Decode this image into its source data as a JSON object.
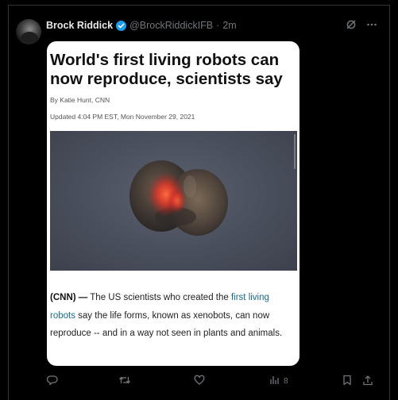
{
  "post": {
    "author_name": "Brock Riddick",
    "handle": "@BrockRiddickIFB",
    "separator": "·",
    "time": "2m",
    "verified": true
  },
  "article": {
    "headline": "World's first living robots can now reproduce, scientists say",
    "byline": "By Katie Hunt, CNN",
    "updated": "Updated 4:04 PM EST, Mon November 29, 2021",
    "body_lead": "(CNN) —",
    "body_before_link": " The US scientists who created the ",
    "body_link": "first living robots",
    "body_after_link": " say the life forms, known as xenobots, can now reproduce -- and in a way not seen in plants and animals."
  },
  "actions": {
    "views": "8"
  },
  "icons": {
    "grok": "grok-icon",
    "more": "more-icon",
    "reply": "reply-icon",
    "repost": "repost-icon",
    "like": "like-icon",
    "views": "views-icon",
    "bookmark": "bookmark-icon",
    "share": "share-icon"
  },
  "colors": {
    "background": "#000000",
    "accent": "#1d9bf0",
    "muted": "#71767b",
    "link": "#196b8c"
  }
}
